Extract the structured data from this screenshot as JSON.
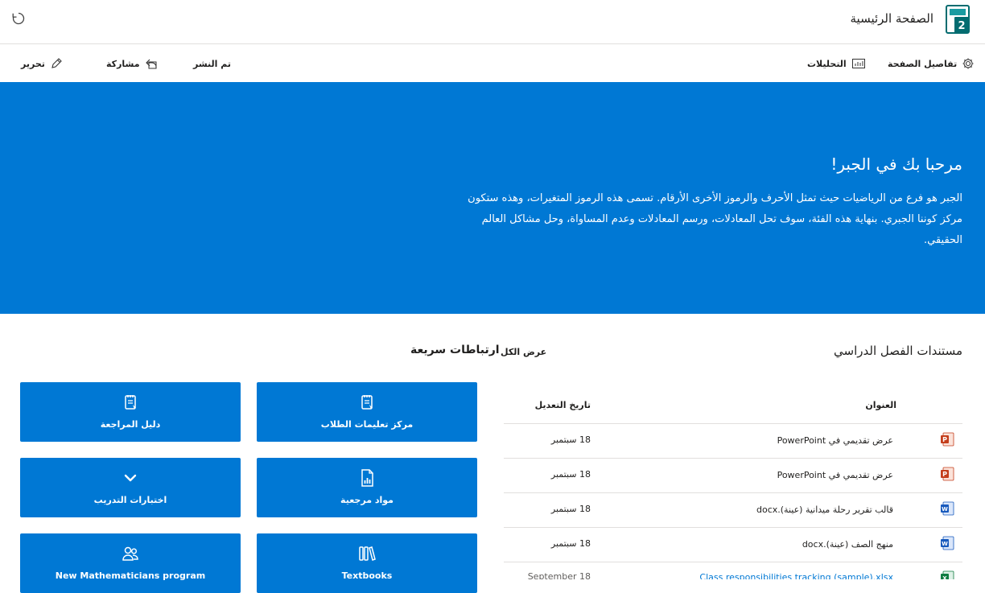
{
  "header": {
    "site_title": "الصفحة الرئيسية",
    "logo_letter": "S"
  },
  "command_bar": {
    "edit": "تحرير",
    "share": "مشاركة",
    "published": "تم النشر",
    "analytics": "التحليلات",
    "page_details": "تفاصيل الصفحة"
  },
  "hero": {
    "title": "مرحبا بك في الجبر!",
    "body": "الجبر هو فرع من الرياضيات حيث تمثل الأحرف والرموز الأخرى الأرقام. تسمى هذه الرموز المتغيرات، وهذه ستكون مركز كوننا الجبري. بنهاية هذه الفئة، سوف تحل المعادلات، ورسم المعادلات وعدم المساواة، وحل مشاكل العالم الحقيقي."
  },
  "documents": {
    "title": "مستندات الفصل الدراسي",
    "view_all": "عرض الكل",
    "columns": {
      "name": "العنوان",
      "modified": "تاريخ التعديل"
    },
    "rows": [
      {
        "name": "عرض تقديمي في PowerPoint",
        "date": "18 سبتمبر",
        "icon": "powerpoint-icon"
      },
      {
        "name": "عرض تقديمي في PowerPoint",
        "date": "18 سبتمبر",
        "icon": "powerpoint-icon"
      },
      {
        "name": "قالب تقرير رحلة ميدانية (عينة).docx",
        "date": "18 سبتمبر",
        "icon": "word-icon"
      },
      {
        "name": "منهج الصف (عينة).docx",
        "date": "18 سبتمبر",
        "icon": "word-icon"
      },
      {
        "name": "Class responsibilities tracking (sample).xlsx",
        "date": "September 18",
        "icon": "excel-icon"
      }
    ]
  },
  "quick_links": {
    "title": "ارتباطات سريعة",
    "tiles": [
      {
        "label": "مركز تعليمات الطلاب",
        "icon": "notebook-icon"
      },
      {
        "label": "دليل المراجعة",
        "icon": "notebook-icon"
      },
      {
        "label": "مواد مرجعية",
        "icon": "chart-document-icon"
      },
      {
        "label": "اختبارات التدريب",
        "icon": "chevron-down-icon"
      },
      {
        "label": "Textbooks",
        "icon": "library-icon"
      },
      {
        "label": "New Mathematicians program",
        "icon": "people-icon"
      }
    ]
  },
  "colors": {
    "accent": "#0078d4",
    "powerpoint": "#c43e1c",
    "word": "#185abd",
    "excel": "#107c41",
    "logo": "#036c70"
  }
}
